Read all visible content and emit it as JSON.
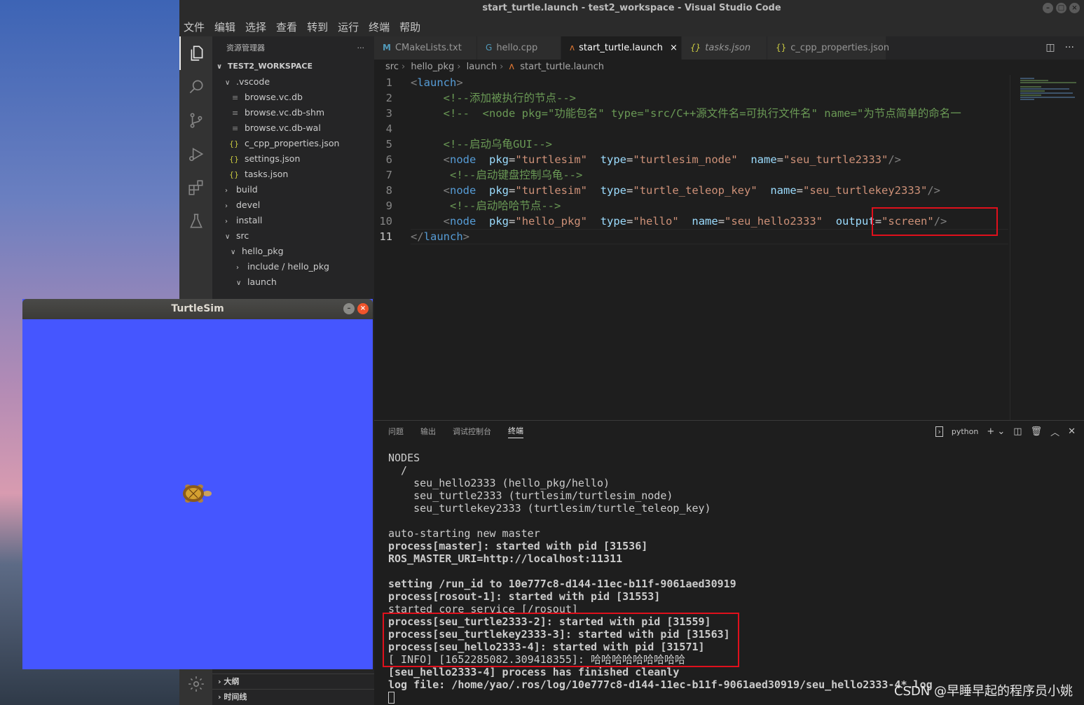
{
  "window": {
    "title": "start_turtle.launch - test2_workspace - Visual Studio Code"
  },
  "menu": [
    "文件",
    "编辑",
    "选择",
    "查看",
    "转到",
    "运行",
    "终端",
    "帮助"
  ],
  "sidebar": {
    "title": "资源管理器",
    "more": "···",
    "workspace": "TEST2_WORKSPACE",
    "tree": [
      {
        "label": ".vscode",
        "chev": "∨",
        "icon": ""
      },
      {
        "label": "browse.vc.db",
        "chev": "",
        "icon": "≡"
      },
      {
        "label": "browse.vc.db-shm",
        "chev": "",
        "icon": "≡"
      },
      {
        "label": "browse.vc.db-wal",
        "chev": "",
        "icon": "≡"
      },
      {
        "label": "c_cpp_properties.json",
        "chev": "",
        "icon": "{}"
      },
      {
        "label": "settings.json",
        "chev": "",
        "icon": "{}"
      },
      {
        "label": "tasks.json",
        "chev": "",
        "icon": "{}"
      },
      {
        "label": "build",
        "chev": "›",
        "icon": ""
      },
      {
        "label": "devel",
        "chev": "›",
        "icon": ""
      },
      {
        "label": "install",
        "chev": "›",
        "icon": ""
      },
      {
        "label": "src",
        "chev": "∨",
        "icon": ""
      },
      {
        "label": "hello_pkg",
        "chev": "∨",
        "icon": ""
      },
      {
        "label": "include / hello_pkg",
        "chev": "›",
        "icon": ""
      },
      {
        "label": "launch",
        "chev": "∨",
        "icon": ""
      }
    ],
    "outline": "大纲",
    "timeline": "时间线"
  },
  "tabs": [
    {
      "label": "CMakeLists.txt",
      "icon": "M"
    },
    {
      "label": "hello.cpp",
      "icon": "G"
    },
    {
      "label": "start_turtle.launch",
      "icon": "ʌ",
      "close": "×"
    },
    {
      "label": "tasks.json",
      "icon": "{}"
    },
    {
      "label": "c_cpp_properties.json",
      "icon": "{}"
    }
  ],
  "breadcrumb": [
    "src",
    "hello_pkg",
    "launch",
    "start_turtle.launch"
  ],
  "code_lines": [
    {
      "n": "1"
    },
    {
      "n": "2"
    },
    {
      "n": "3"
    },
    {
      "n": "4"
    },
    {
      "n": "5"
    },
    {
      "n": "6"
    },
    {
      "n": "7"
    },
    {
      "n": "8"
    },
    {
      "n": "9"
    },
    {
      "n": "10"
    },
    {
      "n": "11"
    }
  ],
  "code": {
    "l1_tag": "launch",
    "l2_cmt": "<!--添加被执行的节点-->",
    "l3_cmt": "<!--  <node pkg=\"功能包名\" type=\"src/C++源文件名=可执行文件名\" name=\"为节点简单的命名一",
    "l5_cmt": "<!--启动乌龟GUI-->",
    "node": "node",
    "pkg": "pkg",
    "type": "type",
    "name": "name",
    "output": "output",
    "l6_pkg": "\"turtlesim\"",
    "l6_type": "\"turtlesim_node\"",
    "l6_name": "\"seu_turtle2333\"",
    "l7_cmt": "<!--启动键盘控制乌龟-->",
    "l8_pkg": "\"turtlesim\"",
    "l8_type": "\"turtle_teleop_key\"",
    "l8_name": "\"seu_turtlekey2333\"",
    "l9_cmt": "<!--启动哈哈节点-->",
    "l10_pkg": "\"hello_pkg\"",
    "l10_type": "\"hello\"",
    "l10_name": "\"seu_hello2333\"",
    "l10_output": "\"screen\""
  },
  "panel": {
    "tabs": [
      "问题",
      "输出",
      "调试控制台",
      "终端"
    ],
    "active_tab": "终端",
    "shell": "python",
    "terminal": [
      {
        "t": "NODES",
        "b": false
      },
      {
        "t": "  /",
        "b": false
      },
      {
        "t": "    seu_hello2333 (hello_pkg/hello)",
        "b": false
      },
      {
        "t": "    seu_turtle2333 (turtlesim/turtlesim_node)",
        "b": false
      },
      {
        "t": "    seu_turtlekey2333 (turtlesim/turtle_teleop_key)",
        "b": false
      },
      {
        "t": "",
        "b": false
      },
      {
        "t": "auto-starting new master",
        "b": false
      },
      {
        "t": "process[master]: started with pid [31536]",
        "b": true
      },
      {
        "t": "ROS_MASTER_URI=http://localhost:11311",
        "b": true
      },
      {
        "t": "",
        "b": false
      },
      {
        "t": "setting /run_id to 10e777c8-d144-11ec-b11f-9061aed30919",
        "b": true
      },
      {
        "t": "process[rosout-1]: started with pid [31553]",
        "b": true
      },
      {
        "t": "started core service [/rosout]",
        "b": false
      },
      {
        "t": "process[seu_turtle2333-2]: started with pid [31559]",
        "b": true
      },
      {
        "t": "process[seu_turtlekey2333-3]: started with pid [31563]",
        "b": true
      },
      {
        "t": "process[seu_hello2333-4]: started with pid [31571]",
        "b": true
      },
      {
        "t": "[ INFO] [1652285082.309418355]: 哈哈哈哈哈哈哈哈哈",
        "b": false
      },
      {
        "t": "[seu_hello2333-4] process has finished cleanly",
        "b": true
      },
      {
        "t": "log file: /home/yao/.ros/log/10e777c8-d144-11ec-b11f-9061aed30919/seu_hello2333-4*.log",
        "b": true
      }
    ]
  },
  "turtlesim": {
    "title": "TurtleSim",
    "bg_color": "#4556ff"
  },
  "watermark": "CSDN @早睡早起的程序员小姚"
}
